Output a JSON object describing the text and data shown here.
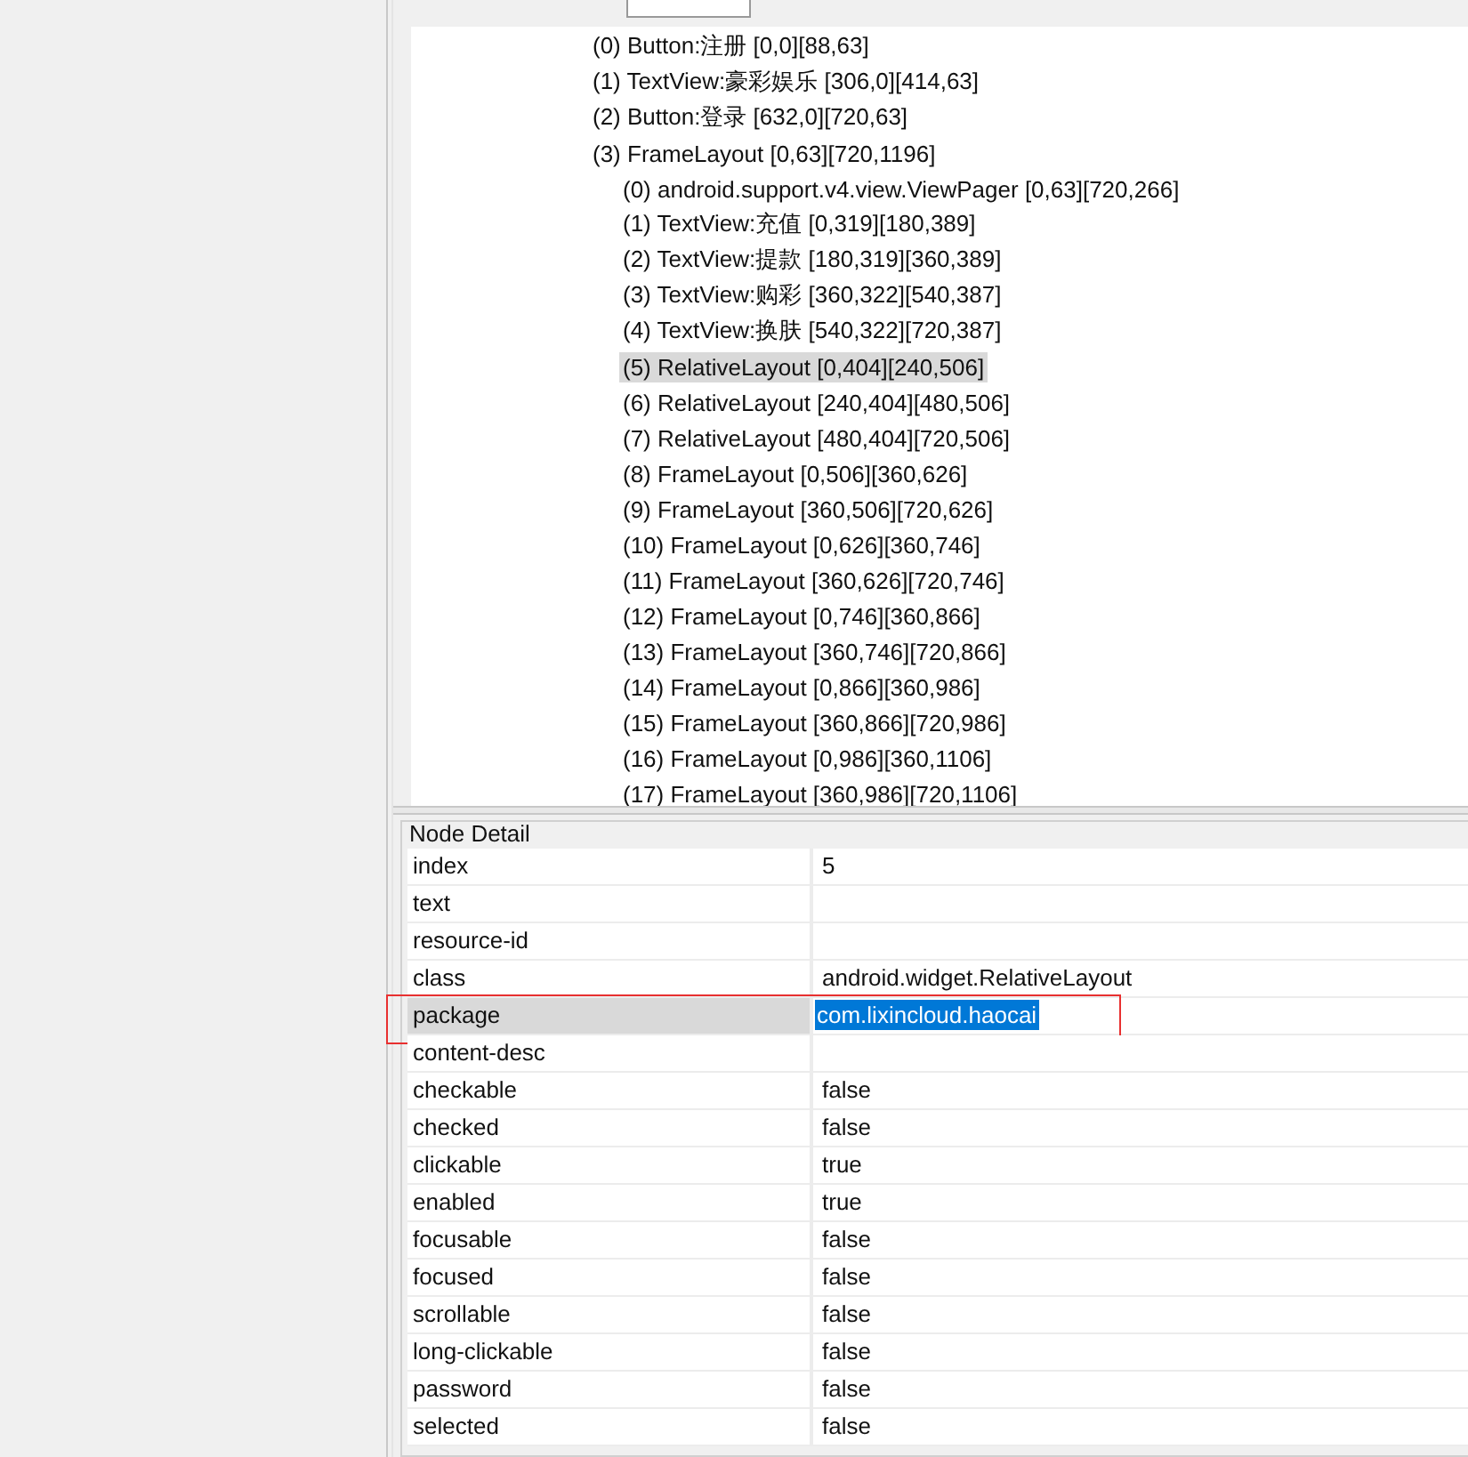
{
  "hierarchy": [
    {
      "label": "(0) Button:注册 [0,0][88,63]",
      "selected": false
    },
    {
      "label": "(1) TextView:豪彩娱乐 [306,0][414,63]",
      "selected": false
    },
    {
      "label": "(2) Button:登录 [632,0][720,63]",
      "selected": false
    },
    {
      "label": "(3) FrameLayout [0,63][720,1196]",
      "selected": false,
      "children": [
        {
          "label": "(0) android.support.v4.view.ViewPager [0,63][720,266]",
          "selected": false
        },
        {
          "label": "(1) TextView:充值 [0,319][180,389]",
          "selected": false
        },
        {
          "label": "(2) TextView:提款 [180,319][360,389]",
          "selected": false
        },
        {
          "label": "(3) TextView:购彩 [360,322][540,387]",
          "selected": false
        },
        {
          "label": "(4) TextView:换肤 [540,322][720,387]",
          "selected": false
        },
        {
          "label": "(5) RelativeLayout [0,404][240,506]",
          "selected": true
        },
        {
          "label": "(6) RelativeLayout [240,404][480,506]",
          "selected": false
        },
        {
          "label": "(7) RelativeLayout [480,404][720,506]",
          "selected": false
        },
        {
          "label": "(8) FrameLayout [0,506][360,626]",
          "selected": false
        },
        {
          "label": "(9) FrameLayout [360,506][720,626]",
          "selected": false
        },
        {
          "label": "(10) FrameLayout [0,626][360,746]",
          "selected": false
        },
        {
          "label": "(11) FrameLayout [360,626][720,746]",
          "selected": false
        },
        {
          "label": "(12) FrameLayout [0,746][360,866]",
          "selected": false
        },
        {
          "label": "(13) FrameLayout [360,746][720,866]",
          "selected": false
        },
        {
          "label": "(14) FrameLayout [0,866][360,986]",
          "selected": false
        },
        {
          "label": "(15) FrameLayout [360,866][720,986]",
          "selected": false
        },
        {
          "label": "(16) FrameLayout [0,986][360,1106]",
          "selected": false
        },
        {
          "label": "(17) FrameLayout [360,986][720,1106]",
          "selected": false
        }
      ]
    }
  ],
  "node_detail": {
    "title": "Node Detail",
    "rows": [
      {
        "key": "index",
        "value": "5",
        "selected": false
      },
      {
        "key": "text",
        "selected": false
      },
      {
        "key": "resource-id",
        "selected": false
      },
      {
        "key": "class",
        "value": "android.widget.RelativeLayout",
        "selected": false
      },
      {
        "key": "package",
        "value": "com.lixincloud.haocai",
        "selected": true
      },
      {
        "key": "content-desc",
        "selected": false
      },
      {
        "key": "checkable",
        "value": "false",
        "selected": false
      },
      {
        "key": "checked",
        "value": "false",
        "selected": false
      },
      {
        "key": "clickable",
        "value": "true",
        "selected": false
      },
      {
        "key": "enabled",
        "value": "true",
        "selected": false
      },
      {
        "key": "focusable",
        "value": "false",
        "selected": false
      },
      {
        "key": "focused",
        "value": "false",
        "selected": false
      },
      {
        "key": "scrollable",
        "value": "false",
        "selected": false
      },
      {
        "key": "long-clickable",
        "value": "false",
        "selected": false
      },
      {
        "key": "password",
        "value": "false",
        "selected": false
      },
      {
        "key": "selected",
        "value": "false",
        "selected": false
      }
    ]
  }
}
